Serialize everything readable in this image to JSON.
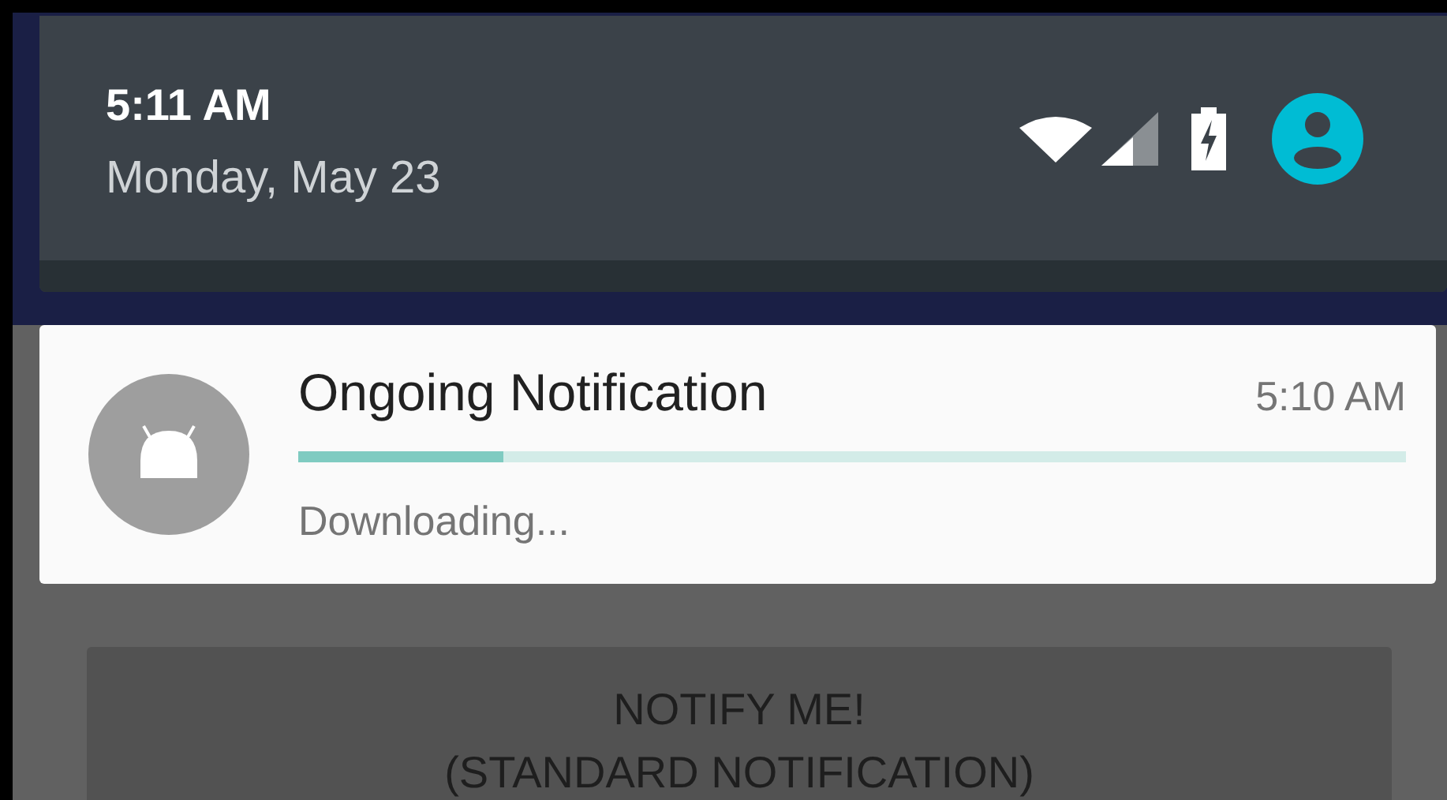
{
  "status_panel": {
    "time": "5:11 AM",
    "date": "Monday, May 23"
  },
  "notification": {
    "title": "Ongoing Notification",
    "time": "5:10 AM",
    "progress": {
      "level": 0.185
    },
    "text": "Downloading..."
  },
  "button": {
    "label": "NOTIFY ME!\n(STANDARD NOTIFICATION)"
  }
}
